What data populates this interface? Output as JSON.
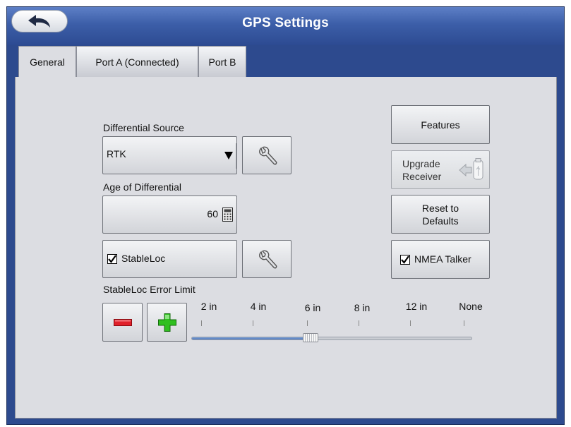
{
  "header": {
    "title": "GPS Settings",
    "back_icon": "undo-arrow-icon"
  },
  "tabs": [
    {
      "label": "General",
      "active": true
    },
    {
      "label": "Port A (Connected)",
      "active": false
    },
    {
      "label": "Port B",
      "active": false
    }
  ],
  "differential": {
    "label": "Differential Source",
    "value": "RTK",
    "settings_icon": "wrench-icon"
  },
  "age": {
    "label": "Age of Differential",
    "value": "60",
    "icon": "calculator-icon"
  },
  "stableloc": {
    "checkbox_label": "StableLoc",
    "checked": true,
    "settings_icon": "wrench-icon",
    "error_limit_label": "StableLoc Error Limit",
    "minus_icon": "minus-icon",
    "plus_icon": "plus-icon",
    "ticks": [
      "2 in",
      "4 in",
      "6 in",
      "8 in",
      "12 in",
      "None"
    ],
    "slider_fraction": 0.41
  },
  "right_buttons": {
    "features": "Features",
    "upgrade_line1": "Upgrade",
    "upgrade_line2": "Receiver",
    "upgrade_icon": "usb-drive-arrow-icon",
    "reset_line1": "Reset to",
    "reset_line2": "Defaults",
    "nmea_label": "NMEA Talker",
    "nmea_checked": true
  },
  "colors": {
    "titlebar": "#3c5ea8",
    "panel": "#dcdde2",
    "minus": "#e0202a",
    "plus": "#2fbf1f"
  }
}
